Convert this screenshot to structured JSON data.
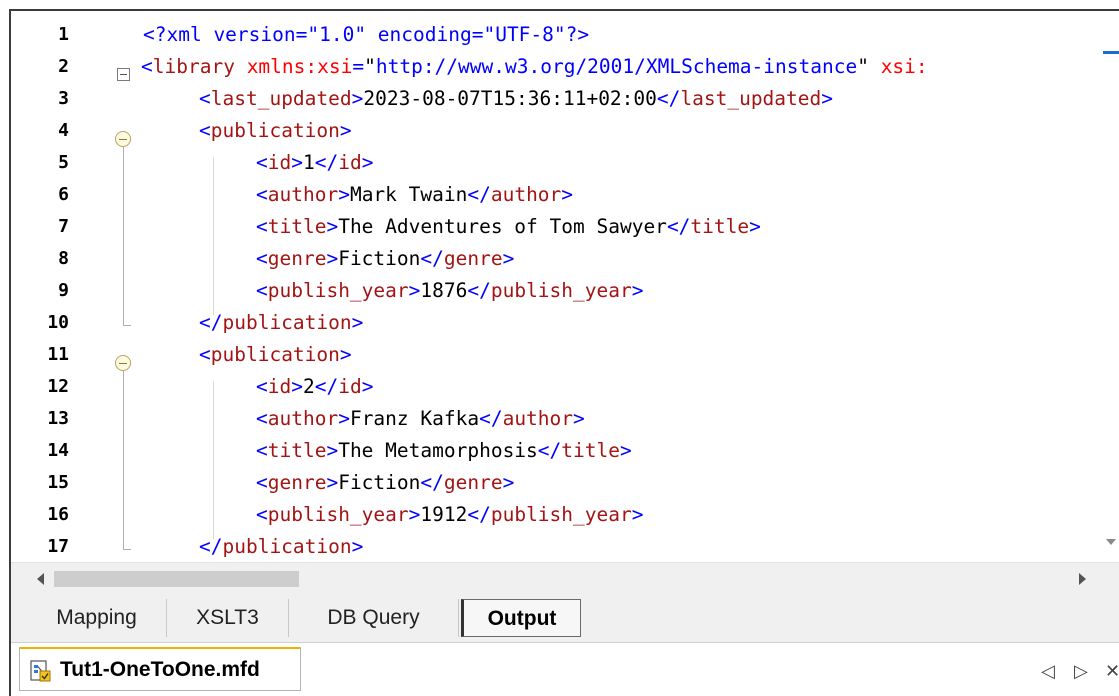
{
  "editor": {
    "lines": [
      {
        "n": "1",
        "parts": [
          [
            "pi",
            "<?xml version=\"1.0\" encoding=\"UTF-8\"?>"
          ]
        ]
      },
      {
        "n": "2",
        "parts": [
          [
            "tag",
            "<"
          ],
          [
            "tn",
            "library"
          ],
          [
            "txt",
            " "
          ],
          [
            "an",
            "xmlns:xsi"
          ],
          [
            "tag",
            "="
          ],
          [
            "txt",
            "\""
          ],
          [
            "av",
            "http://www.w3.org/2001/XMLSchema-instance"
          ],
          [
            "txt",
            "\" "
          ],
          [
            "an",
            "xsi:"
          ]
        ]
      },
      {
        "n": "3",
        "parts": [
          [
            "tag",
            "<"
          ],
          [
            "tn",
            "last_updated"
          ],
          [
            "tag",
            ">"
          ],
          [
            "txt",
            "2023-08-07T15:36:11+02:00"
          ],
          [
            "tag",
            "</"
          ],
          [
            "tn",
            "last_updated"
          ],
          [
            "tag",
            ">"
          ]
        ]
      },
      {
        "n": "4",
        "parts": [
          [
            "tag",
            "<"
          ],
          [
            "tn",
            "publication"
          ],
          [
            "tag",
            ">"
          ]
        ]
      },
      {
        "n": "5",
        "parts": [
          [
            "tag",
            "<"
          ],
          [
            "tn",
            "id"
          ],
          [
            "tag",
            ">"
          ],
          [
            "txt",
            "1"
          ],
          [
            "tag",
            "</"
          ],
          [
            "tn",
            "id"
          ],
          [
            "tag",
            ">"
          ]
        ]
      },
      {
        "n": "6",
        "parts": [
          [
            "tag",
            "<"
          ],
          [
            "tn",
            "author"
          ],
          [
            "tag",
            ">"
          ],
          [
            "txt",
            "Mark Twain"
          ],
          [
            "tag",
            "</"
          ],
          [
            "tn",
            "author"
          ],
          [
            "tag",
            ">"
          ]
        ]
      },
      {
        "n": "7",
        "parts": [
          [
            "tag",
            "<"
          ],
          [
            "tn",
            "title"
          ],
          [
            "tag",
            ">"
          ],
          [
            "txt",
            "The Adventures of Tom Sawyer"
          ],
          [
            "tag",
            "</"
          ],
          [
            "tn",
            "title"
          ],
          [
            "tag",
            ">"
          ]
        ]
      },
      {
        "n": "8",
        "parts": [
          [
            "tag",
            "<"
          ],
          [
            "tn",
            "genre"
          ],
          [
            "tag",
            ">"
          ],
          [
            "txt",
            "Fiction"
          ],
          [
            "tag",
            "</"
          ],
          [
            "tn",
            "genre"
          ],
          [
            "tag",
            ">"
          ]
        ]
      },
      {
        "n": "9",
        "parts": [
          [
            "tag",
            "<"
          ],
          [
            "tn",
            "publish_year"
          ],
          [
            "tag",
            ">"
          ],
          [
            "txt",
            "1876"
          ],
          [
            "tag",
            "</"
          ],
          [
            "tn",
            "publish_year"
          ],
          [
            "tag",
            ">"
          ]
        ]
      },
      {
        "n": "10",
        "parts": [
          [
            "tag",
            "</"
          ],
          [
            "tn",
            "publication"
          ],
          [
            "tag",
            ">"
          ]
        ]
      },
      {
        "n": "11",
        "parts": [
          [
            "tag",
            "<"
          ],
          [
            "tn",
            "publication"
          ],
          [
            "tag",
            ">"
          ]
        ]
      },
      {
        "n": "12",
        "parts": [
          [
            "tag",
            "<"
          ],
          [
            "tn",
            "id"
          ],
          [
            "tag",
            ">"
          ],
          [
            "txt",
            "2"
          ],
          [
            "tag",
            "</"
          ],
          [
            "tn",
            "id"
          ],
          [
            "tag",
            ">"
          ]
        ]
      },
      {
        "n": "13",
        "parts": [
          [
            "tag",
            "<"
          ],
          [
            "tn",
            "author"
          ],
          [
            "tag",
            ">"
          ],
          [
            "txt",
            "Franz Kafka"
          ],
          [
            "tag",
            "</"
          ],
          [
            "tn",
            "author"
          ],
          [
            "tag",
            ">"
          ]
        ]
      },
      {
        "n": "14",
        "parts": [
          [
            "tag",
            "<"
          ],
          [
            "tn",
            "title"
          ],
          [
            "tag",
            ">"
          ],
          [
            "txt",
            "The Metamorphosis"
          ],
          [
            "tag",
            "</"
          ],
          [
            "tn",
            "title"
          ],
          [
            "tag",
            ">"
          ]
        ]
      },
      {
        "n": "15",
        "parts": [
          [
            "tag",
            "<"
          ],
          [
            "tn",
            "genre"
          ],
          [
            "tag",
            ">"
          ],
          [
            "txt",
            "Fiction"
          ],
          [
            "tag",
            "</"
          ],
          [
            "tn",
            "genre"
          ],
          [
            "tag",
            ">"
          ]
        ]
      },
      {
        "n": "16",
        "parts": [
          [
            "tag",
            "<"
          ],
          [
            "tn",
            "publish_year"
          ],
          [
            "tag",
            ">"
          ],
          [
            "txt",
            "1912"
          ],
          [
            "tag",
            "</"
          ],
          [
            "tn",
            "publish_year"
          ],
          [
            "tag",
            ">"
          ]
        ]
      },
      {
        "n": "17",
        "parts": [
          [
            "tag",
            "</"
          ],
          [
            "tn",
            "publication"
          ],
          [
            "tag",
            ">"
          ]
        ]
      }
    ]
  },
  "view_tabs": [
    {
      "label": "Mapping",
      "active": false
    },
    {
      "label": "XSLT3",
      "active": false
    },
    {
      "label": "DB Query",
      "active": false
    },
    {
      "label": "Output",
      "active": true
    }
  ],
  "document_tab": {
    "label": "Tut1-OneToOne.mfd",
    "icon": "mapping-file-icon"
  },
  "nav": {
    "prev": "◁",
    "next": "▷",
    "close": "✕"
  },
  "colors": {
    "tag": "#0000ff",
    "tag_name": "#a31515",
    "attr_name": "#ff0000",
    "attr_value": "#0000ff",
    "accent": "#1e6bd6"
  }
}
